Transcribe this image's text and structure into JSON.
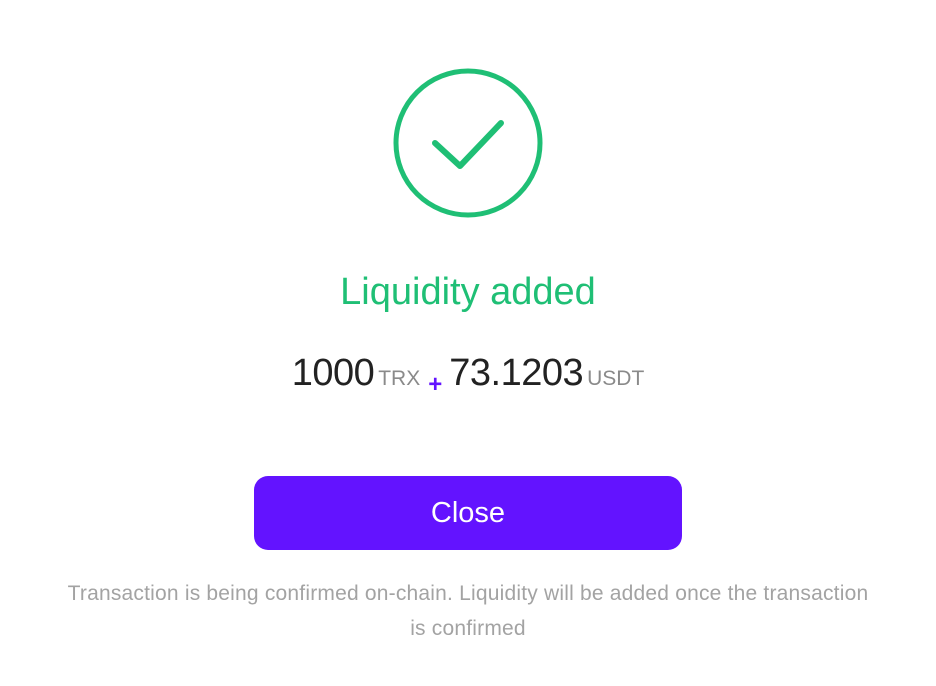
{
  "status_icon": "check-circle-icon",
  "colors": {
    "success": "#1fbf75",
    "primary": "#6313ff",
    "plus": "#6313ff"
  },
  "title": "Liquidity added",
  "amounts": {
    "first_value": "1000",
    "first_unit": "TRX",
    "separator": "+",
    "second_value": "73.1203",
    "second_unit": "USDT"
  },
  "close_label": "Close",
  "note": "Transaction is being confirmed on-chain. Liquidity will be added once the transaction is confirmed"
}
